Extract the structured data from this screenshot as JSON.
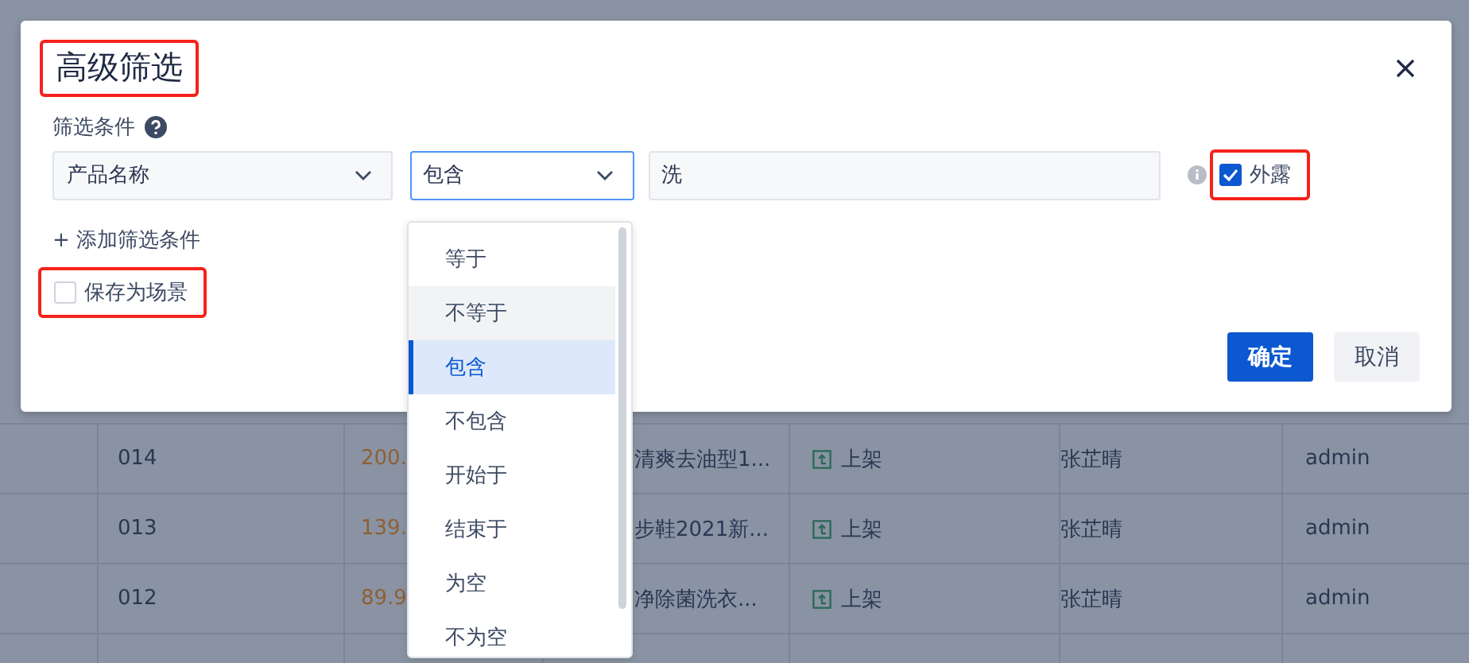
{
  "dialog": {
    "title": {
      "text": "高级筛选",
      "highlighted": true
    },
    "section_label": "筛选条件",
    "condition": {
      "field": "产品名称",
      "operator": "包含",
      "value": "洗",
      "expose": {
        "label": "外露",
        "checked": true,
        "highlighted": true
      }
    },
    "add_condition": "+ 添加筛选条件",
    "save_scene": {
      "label": "保存为场景",
      "checked": false,
      "highlighted": true
    },
    "buttons": [
      {
        "label": "确定",
        "kind": "primary"
      },
      {
        "label": "取消",
        "kind": "secondary"
      }
    ]
  },
  "operator_menu": {
    "options": [
      {
        "label": "等于",
        "selected": false,
        "hovered": false
      },
      {
        "label": "不等于",
        "selected": false,
        "hovered": true
      },
      {
        "label": "包含",
        "selected": true,
        "hovered": false
      },
      {
        "label": "不包含",
        "selected": false,
        "hovered": false
      },
      {
        "label": "开始于",
        "selected": false,
        "hovered": false
      },
      {
        "label": "结束于",
        "selected": false,
        "hovered": false
      },
      {
        "label": "为空",
        "selected": false,
        "hovered": false
      },
      {
        "label": "不为空",
        "selected": false,
        "hovered": false
      }
    ]
  },
  "table": {
    "rows": [
      {
        "id": "014",
        "price": "200.",
        "product": "清爽去油型1...",
        "status": "上架",
        "owner": "张芷晴",
        "creator": "admin"
      },
      {
        "id": "013",
        "price": "139.",
        "product": "步鞋2021新...",
        "status": "上架",
        "owner": "张芷晴",
        "creator": "admin"
      },
      {
        "id": "012",
        "price": "89.9",
        "product": "净除菌洗衣...",
        "status": "上架",
        "owner": "张芷晴",
        "creator": "admin"
      }
    ]
  }
}
